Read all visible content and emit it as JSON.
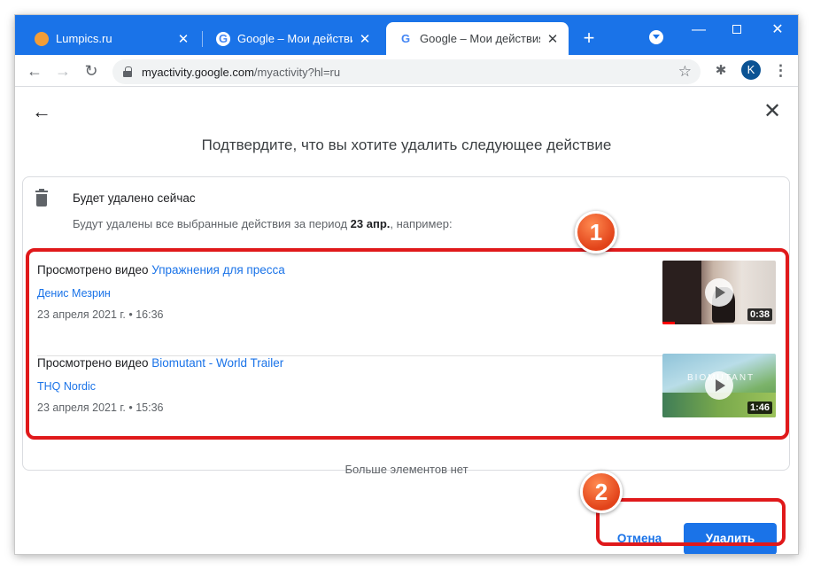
{
  "browser": {
    "tabs": [
      {
        "title": "Lumpics.ru",
        "icon": "lumpics-favicon",
        "active": false
      },
      {
        "title": "Google – Мои действия",
        "icon": "google-favicon",
        "active": false
      },
      {
        "title": "Google – Мои действия",
        "icon": "google-favicon",
        "active": true
      }
    ],
    "favicon_letter": "G",
    "new_tab": "+",
    "url_host": "myactivity.google.com",
    "url_path": "/myactivity?hl=ru",
    "profile_initial": "K"
  },
  "dialog": {
    "title": "Подтвердите, что вы хотите удалить следующее действие",
    "section_title": "Будет удалено сейчас",
    "section_sub_prefix": "Будут удалены все выбранные действия за период ",
    "section_sub_period": "23 апр.",
    "section_sub_suffix": ", например:",
    "items": [
      {
        "prefix": "Просмотрено видео ",
        "video_title": "Упражнения для пресса",
        "channel": "Денис Мезрин",
        "date": "23 апреля 2021 г. • 16:36",
        "duration": "0:38"
      },
      {
        "prefix": "Просмотрено видео ",
        "video_title": "Biomutant - World Trailer",
        "channel": "THQ Nordic",
        "date": "23 апреля 2021 г. • 15:36",
        "duration": "1:46",
        "thumb_text": "BIOMUTANT"
      }
    ],
    "no_more": "Больше элементов нет",
    "cancel_label": "Отмена",
    "delete_label": "Удалить"
  },
  "annotations": {
    "badge1": "1",
    "badge2": "2"
  },
  "colors": {
    "accent": "#1a73e8",
    "highlight": "#e0191b"
  }
}
